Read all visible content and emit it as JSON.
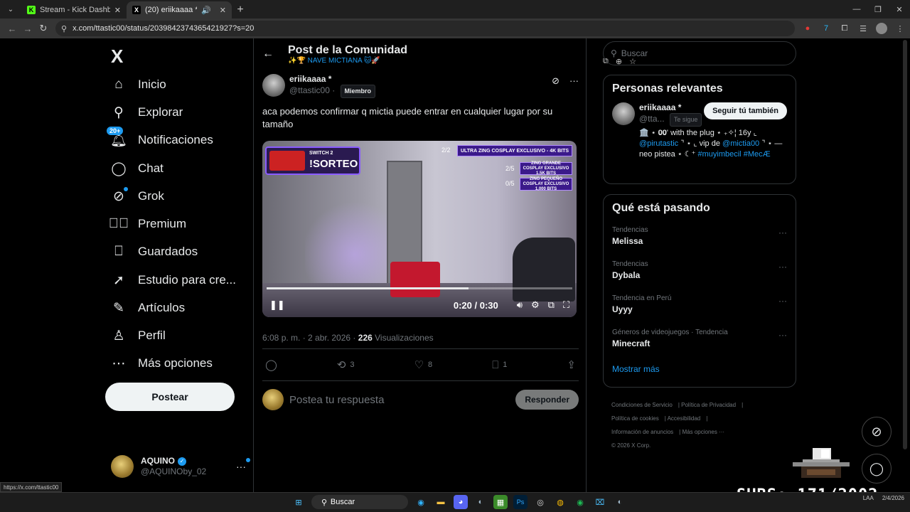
{
  "browser": {
    "tabs": [
      {
        "title": "Stream - Kick Dashboard",
        "favicon": "K"
      },
      {
        "title": "(20) eriikaaaa * en X: \"aca p",
        "favicon": "X"
      }
    ],
    "new_tab": "+",
    "url": "x.com/ttastic00/status/2039842374365421927?s=20"
  },
  "nav": {
    "logo": "X",
    "items": [
      {
        "label": "Inicio",
        "icon": "home-icon"
      },
      {
        "label": "Explorar",
        "icon": "search-icon"
      },
      {
        "label": "Notificaciones",
        "icon": "bell-icon",
        "badge": "20+"
      },
      {
        "label": "Chat",
        "icon": "chat-icon"
      },
      {
        "label": "Grok",
        "icon": "grok-icon"
      },
      {
        "label": "Premium",
        "icon": "verified-icon"
      },
      {
        "label": "Guardados",
        "icon": "bookmark-icon"
      },
      {
        "label": "Estudio para cre...",
        "icon": "rocket-icon"
      },
      {
        "label": "Artículos",
        "icon": "article-icon"
      },
      {
        "label": "Perfil",
        "icon": "person-icon"
      },
      {
        "label": "Más opciones",
        "icon": "more-icon"
      }
    ],
    "post_button": "Postear",
    "account": {
      "name": "AQUINO",
      "handle": "@AQUINOby_02"
    }
  },
  "header": {
    "title": "Post de la Comunidad",
    "subtitle": "✨🏆 NAVE MICTIANA 🐱🚀"
  },
  "post": {
    "author": "eriikaaaa *",
    "handle": "@ttastic00",
    "role_tag": "Miembro",
    "text": "aca podemos confirmar q mictia puede entrar en cualquier lugar por su tamaño",
    "video": {
      "counter": "2/2",
      "promo_top": "ULTRA ZING COSPLAY EXCLUSIVO - 4K BITS",
      "promo_mid": "ZING GRANDE COSPLAY EXCLUSIVO 1.5K BITS",
      "promo_mid_count": "2/5",
      "promo_low": "ZING PEQUEÑO COSPLAY EXCLUSIVO 1,000 BITS",
      "promo_low_count": "0/5",
      "switch_label": "SWITCH 2",
      "sorteo_label": "!SORTEO",
      "time": "0:20 / 0:30",
      "progress": 0.66
    },
    "time": "6:08 p. m. · 2 abr. 2026 ·",
    "views_count": "226",
    "views_label": "Visualizaciones",
    "reposts": "3",
    "likes": "8",
    "bookmarks": "1",
    "reply_placeholder": "Postea tu respuesta",
    "reply_button": "Responder"
  },
  "sidebar": {
    "search_placeholder": "Buscar",
    "relevant": {
      "title": "Personas relevantes",
      "name": "eriikaaaa *",
      "handle": "@tta...",
      "follows_you": "Te sigue",
      "follow_button": "Seguir tú también",
      "bio_plain1": "🏛️ ⋆ 𝟎𝟎' with the plug ⋆ ₊✧¦ 16y ⌞",
      "bio_link1": "@pirutastic",
      "bio_plain2": "⌝ ⋆ ⌞ vip de",
      "bio_link2": "@mictia00",
      "bio_plain3": "⌝ ⋆ — neo pistea ⋆ ☾⁺",
      "bio_link3": "#muyimbecil",
      "bio_link4": "#MecÆ"
    },
    "trends": {
      "title": "Qué está pasando",
      "items": [
        {
          "category": "Tendencias",
          "name": "Melissa"
        },
        {
          "category": "Tendencias",
          "name": "Dybala"
        },
        {
          "category": "Tendencia en Perú",
          "name": "Uyyy"
        },
        {
          "category": "Géneros de videojuegos · Tendencia",
          "name": "Minecraft"
        }
      ],
      "show_more": "Mostrar más"
    },
    "footer": {
      "terms": "Condiciones de Servicio",
      "privacy": "Política de Privacidad",
      "cookies": "Política de cookies",
      "accessibility": "Accesibilidad",
      "ads": "Información de anuncios",
      "more": "Más opciones ···",
      "copyright": "© 2026 X Corp."
    }
  },
  "overlay": {
    "status_url": "https://x.com/ttastic00",
    "subs": "SUBS: 171/2002"
  },
  "taskbar": {
    "search": "Buscar",
    "lang": "LAA",
    "date": "2/4/2026"
  },
  "colors": {
    "accent": "#1d9bf0",
    "background": "#000000",
    "border": "#2f3336"
  }
}
